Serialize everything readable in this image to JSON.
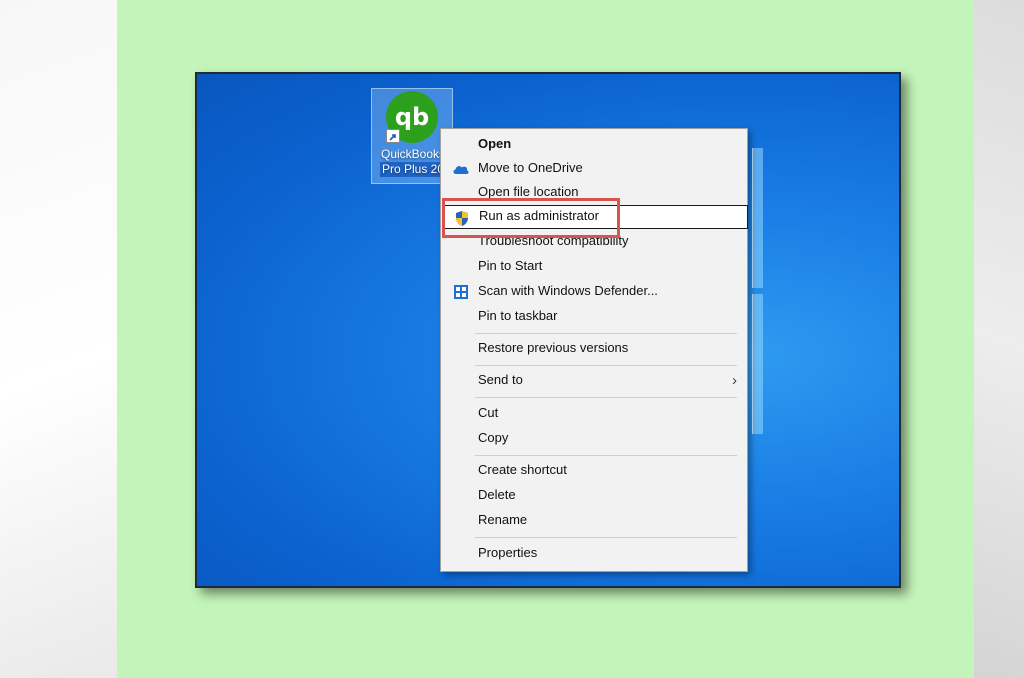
{
  "desktop": {
    "icon": {
      "logo_text": "qb",
      "label_line1": "QuickBooks",
      "label_line2": "Pro Plus 20"
    }
  },
  "context_menu": {
    "items": [
      {
        "label": "Open",
        "bold": true,
        "icon": ""
      },
      {
        "label": "Move to OneDrive",
        "icon": "onedrive-cloud-icon"
      },
      {
        "label": "Open file location",
        "icon": ""
      },
      {
        "label": "Run as administrator",
        "icon": "uac-shield-icon",
        "highlighted": true
      },
      {
        "label": "Troubleshoot compatibility",
        "icon": ""
      },
      {
        "label": "Pin to Start",
        "icon": ""
      },
      {
        "label": "Scan with Windows Defender...",
        "icon": "defender-icon"
      },
      {
        "label": "Pin to taskbar",
        "icon": ""
      },
      {
        "label": "Restore previous versions",
        "icon": ""
      },
      {
        "label": "Send to",
        "icon": "",
        "submenu": true
      },
      {
        "label": "Cut",
        "icon": ""
      },
      {
        "label": "Copy",
        "icon": ""
      },
      {
        "label": "Create shortcut",
        "icon": ""
      },
      {
        "label": "Delete",
        "icon": ""
      },
      {
        "label": "Rename",
        "icon": ""
      },
      {
        "label": "Properties",
        "icon": ""
      }
    ],
    "submenu_glyph": "›"
  },
  "colors": {
    "green_panel": "#c3f4b9",
    "desktop_blue": "#1a7fe6",
    "highlight_red": "#d9534f",
    "qb_green": "#2ca01c"
  }
}
